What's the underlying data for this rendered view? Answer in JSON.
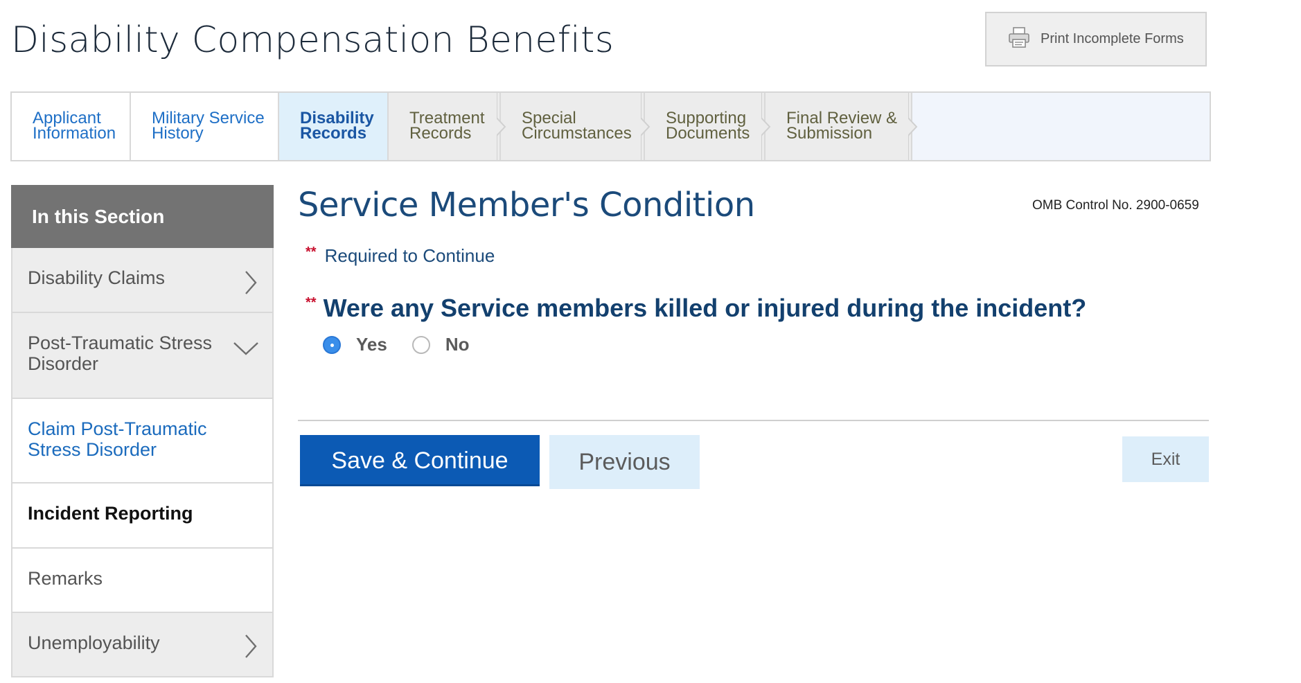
{
  "header": {
    "title": "Disability Compensation Benefits",
    "print_label": "Print Incomplete Forms",
    "print_icon": "printer-icon"
  },
  "steps": [
    {
      "label": "Applicant\nInformation",
      "state": "done"
    },
    {
      "label": "Military Service\nHistory",
      "state": "done"
    },
    {
      "label": "Disability\nRecords",
      "state": "active"
    },
    {
      "label": "Treatment\nRecords",
      "state": "todo"
    },
    {
      "label": "Special\nCircumstances",
      "state": "todo"
    },
    {
      "label": "Supporting\nDocuments",
      "state": "todo"
    },
    {
      "label": "Final Review &\nSubmission",
      "state": "todo"
    }
  ],
  "sidebar": {
    "heading": "In this Section",
    "items": [
      {
        "label": "Disability Claims",
        "icon": "chevron-right-icon"
      },
      {
        "label": "Post-Traumatic Stress\nDisorder",
        "icon": "chevron-down-icon"
      },
      {
        "label": "Claim Post-Traumatic\nStress Disorder"
      },
      {
        "label": "Incident Reporting"
      },
      {
        "label": "Remarks"
      },
      {
        "label": "Unemployability",
        "icon": "chevron-right-icon"
      }
    ]
  },
  "main": {
    "title": "Service Member's Condition",
    "omb": "OMB Control No. 2900-0659",
    "required_marker": "**",
    "required_note": "Required to Continue",
    "question": "Were any Service members killed or injured during the incident?",
    "options": [
      {
        "label": "Yes",
        "selected": true
      },
      {
        "label": "No",
        "selected": false
      }
    ]
  },
  "buttons": {
    "save": "Save & Continue",
    "previous": "Previous",
    "exit": "Exit"
  },
  "colors": {
    "primary": "#0c5ab4",
    "title": "#1b4a7a",
    "required": "#c8102e",
    "active_step_bg": "#dff0fb",
    "link": "#1b6bbd"
  }
}
